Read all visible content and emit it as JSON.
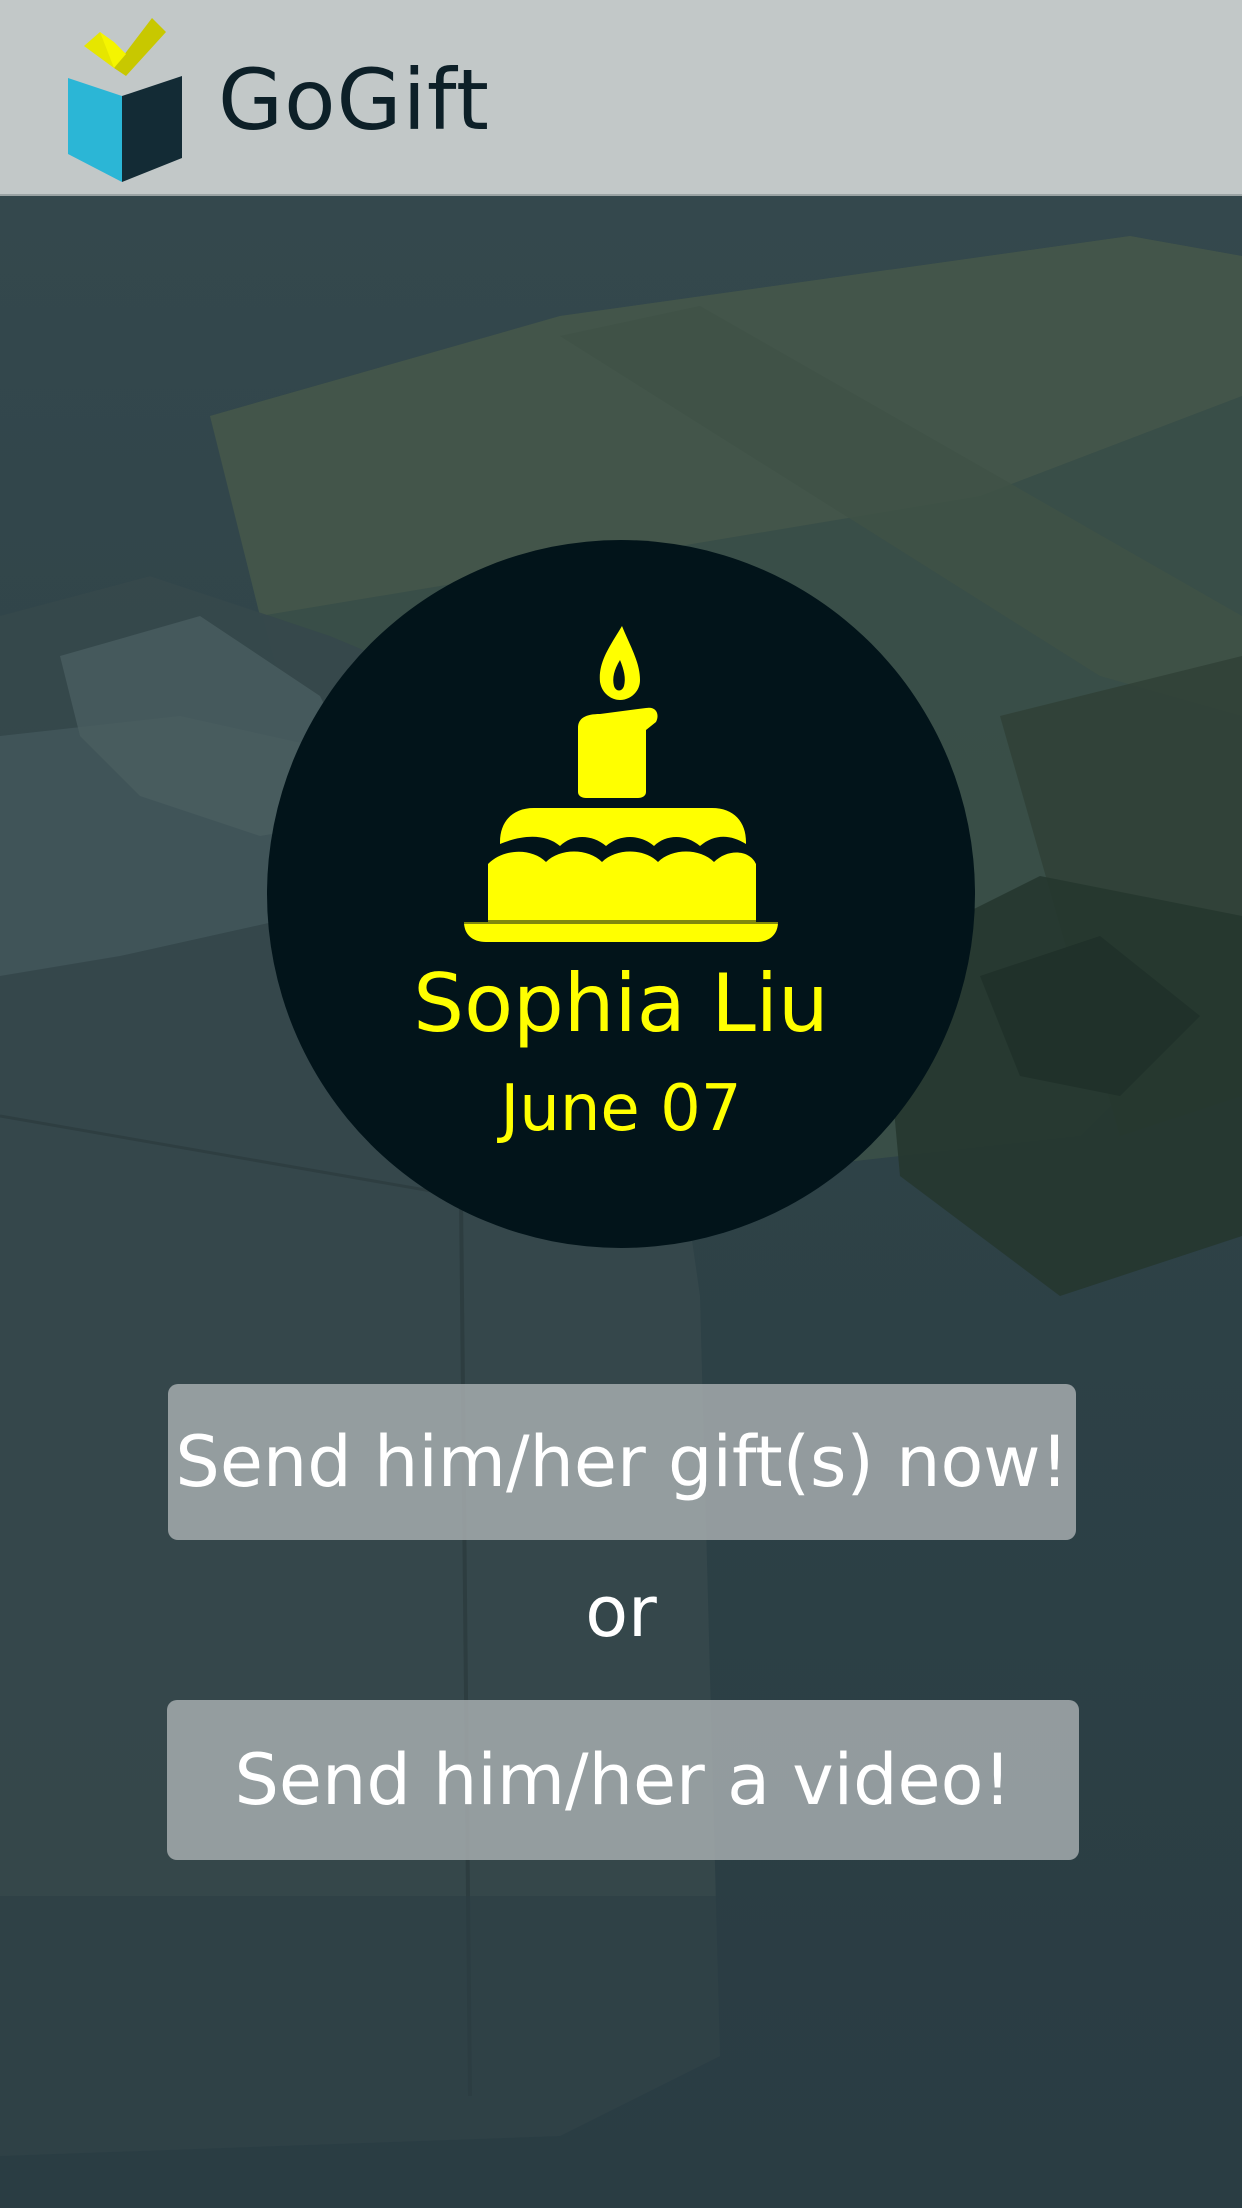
{
  "app": {
    "name": "GoGift",
    "logo_icon": "gift-box-icon"
  },
  "birthday": {
    "icon": "birthday-cake-icon",
    "name": "Sophia Liu",
    "date": "June 07"
  },
  "actions": {
    "send_gift_label": "Send him/her gift(s) now!",
    "separator": "or",
    "send_video_label": "Send him/her a video!"
  },
  "colors": {
    "header_bg": "#c2c8c8",
    "accent_yellow": "#ffff00",
    "logo_blue": "#2bb6d6",
    "circle_bg": "#02141a"
  }
}
